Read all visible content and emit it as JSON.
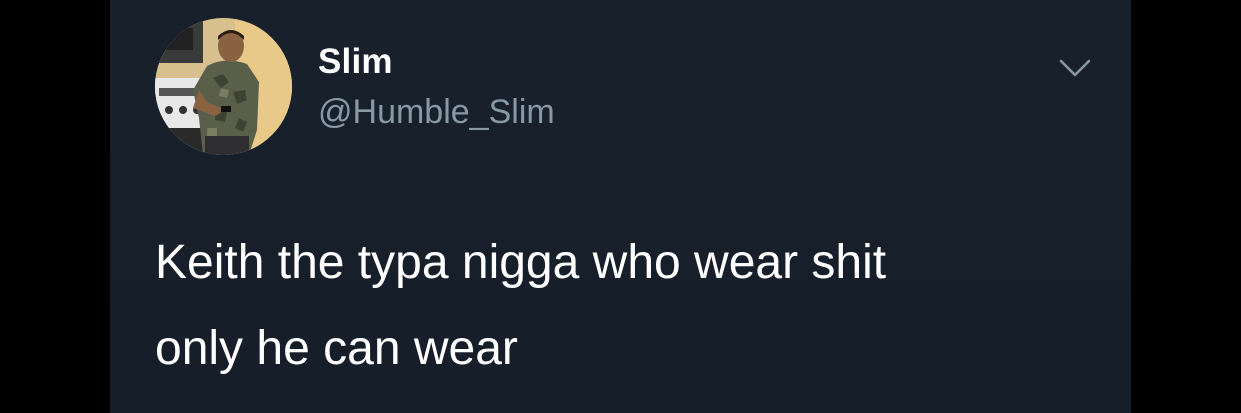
{
  "tweet": {
    "display_name": "Slim",
    "handle": "@Humble_Slim",
    "text": "Keith the typa nigga who wear shit\nonly he can wear",
    "avatar_icon": "profile-photo",
    "menu_icon": "chevron-down-icon"
  },
  "colors": {
    "background": "#161e2a",
    "text_primary": "#ffffff",
    "text_secondary": "#8899a6",
    "chevron": "#8899a6"
  }
}
